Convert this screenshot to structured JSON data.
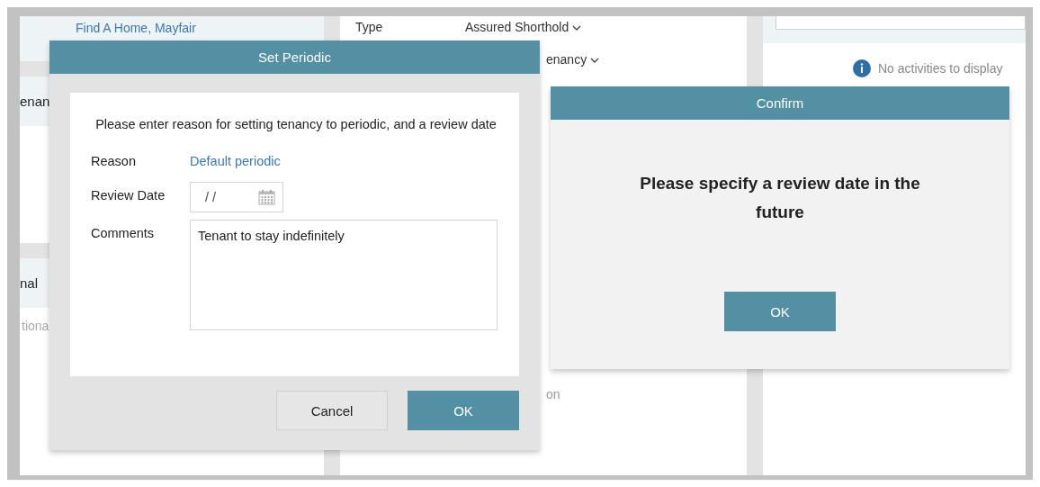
{
  "background": {
    "left_panel": {
      "link": "Find A Home, Mayfair",
      "heading_1": "enan",
      "heading_2": "nal",
      "caption": "tiona"
    },
    "middle_panel": {
      "rows": [
        {
          "kind": "field",
          "label": "Type",
          "value": "Assured Shorthold",
          "dropdown": true
        },
        {
          "kind": "fragment",
          "value": "enancy",
          "dropdown": true
        },
        {
          "kind": "caption",
          "value": "on"
        }
      ]
    },
    "right_panel": {
      "empty_message": "No activities to display"
    }
  },
  "set_periodic_dialog": {
    "title": "Set Periodic",
    "instruction": "Please enter reason for setting tenancy to periodic, and a review date",
    "fields": [
      {
        "kind": "link",
        "label": "Reason",
        "value": "Default periodic"
      },
      {
        "kind": "date",
        "label": "Review Date",
        "value": "/ /"
      },
      {
        "kind": "textarea",
        "label": "Comments",
        "value": "Tenant to stay indefinitely"
      }
    ],
    "buttons": [
      {
        "label": "Cancel",
        "kind": "secondary"
      },
      {
        "label": "OK",
        "kind": "primary"
      }
    ]
  },
  "confirm_dialog": {
    "title": "Confirm",
    "message": "Please specify a review date in the future",
    "buttons": [
      {
        "label": "OK",
        "kind": "primary"
      }
    ]
  }
}
